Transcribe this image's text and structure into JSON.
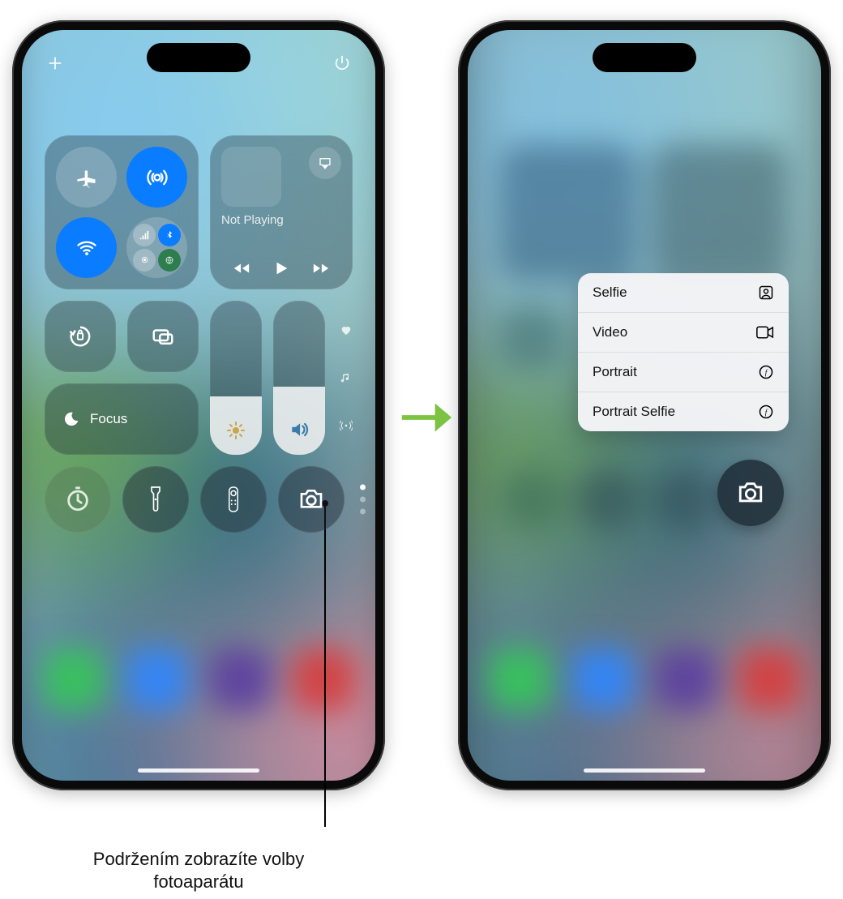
{
  "media": {
    "status": "Not Playing"
  },
  "focus": {
    "label": "Focus"
  },
  "sliders": {
    "brightness_pct": 38,
    "volume_pct": 44
  },
  "context_menu": {
    "items": [
      {
        "label": "Selfie",
        "icon": "person-square-icon"
      },
      {
        "label": "Video",
        "icon": "video-icon"
      },
      {
        "label": "Portrait",
        "icon": "aperture-icon"
      },
      {
        "label": "Portrait Selfie",
        "icon": "aperture-icon"
      }
    ]
  },
  "caption": "Podržením zobrazíte volby fotoaparátu"
}
